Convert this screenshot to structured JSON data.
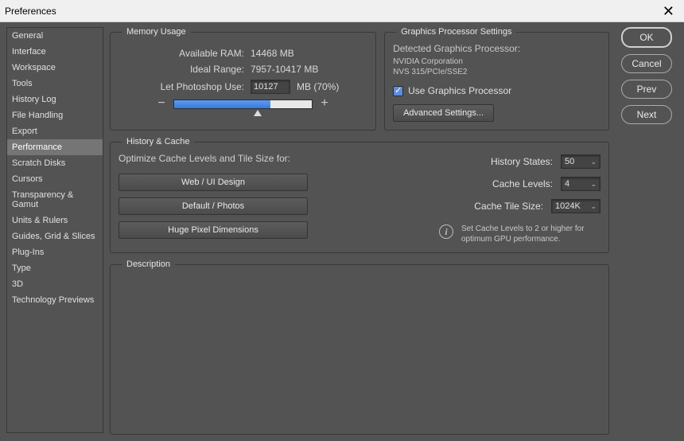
{
  "window": {
    "title": "Preferences"
  },
  "sidebar": {
    "items": [
      {
        "label": "General"
      },
      {
        "label": "Interface"
      },
      {
        "label": "Workspace"
      },
      {
        "label": "Tools"
      },
      {
        "label": "History Log"
      },
      {
        "label": "File Handling"
      },
      {
        "label": "Export"
      },
      {
        "label": "Performance"
      },
      {
        "label": "Scratch Disks"
      },
      {
        "label": "Cursors"
      },
      {
        "label": "Transparency & Gamut"
      },
      {
        "label": "Units & Rulers"
      },
      {
        "label": "Guides, Grid & Slices"
      },
      {
        "label": "Plug-Ins"
      },
      {
        "label": "Type"
      },
      {
        "label": "3D"
      },
      {
        "label": "Technology Previews"
      }
    ],
    "selected_index": 7
  },
  "memory": {
    "legend": "Memory Usage",
    "available_label": "Available RAM:",
    "available_value": "14468 MB",
    "ideal_label": "Ideal Range:",
    "ideal_value": "7957-10417 MB",
    "let_use_label": "Let Photoshop Use:",
    "let_use_value": "10127",
    "let_use_suffix": "MB (70%)",
    "minus": "−",
    "plus": "+"
  },
  "gpu": {
    "legend": "Graphics Processor Settings",
    "detected_label": "Detected Graphics Processor:",
    "vendor": "NVIDIA Corporation",
    "model": "NVS 315/PCIe/SSE2",
    "use_gpu_label": "Use Graphics Processor",
    "advanced_label": "Advanced Settings..."
  },
  "history": {
    "legend": "History & Cache",
    "optimize_label": "Optimize Cache Levels and Tile Size for:",
    "buttons": {
      "web": "Web / UI Design",
      "default": "Default / Photos",
      "huge": "Huge Pixel Dimensions"
    },
    "states_label": "History States:",
    "states_value": "50",
    "cache_levels_label": "Cache Levels:",
    "cache_levels_value": "4",
    "tile_size_label": "Cache Tile Size:",
    "tile_size_value": "1024K",
    "info_text": "Set Cache Levels to 2 or higher for optimum GPU performance."
  },
  "description": {
    "legend": "Description"
  },
  "actions": {
    "ok": "OK",
    "cancel": "Cancel",
    "prev": "Prev",
    "next": "Next"
  }
}
